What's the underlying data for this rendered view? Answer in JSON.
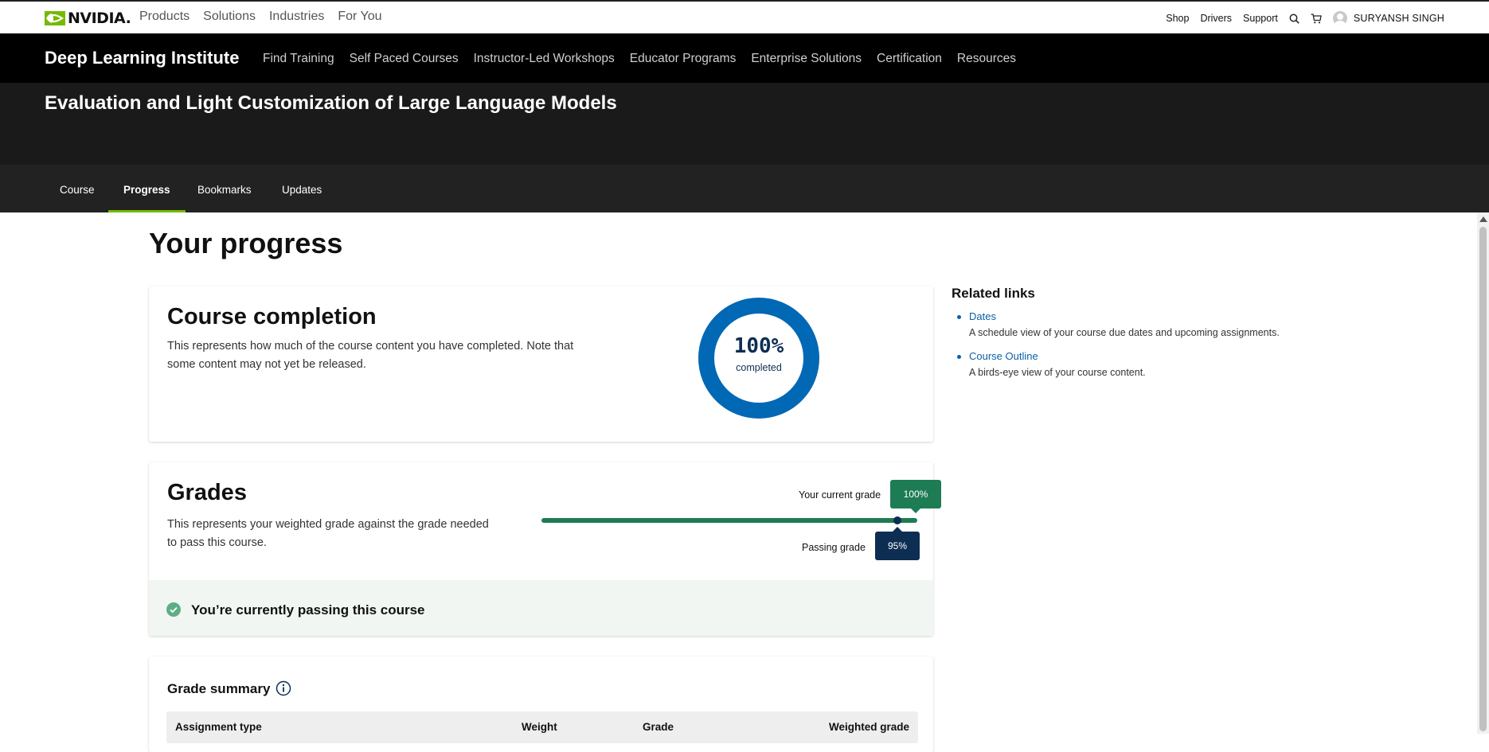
{
  "topbar": {
    "brand": "NVIDIA.",
    "nav": [
      "Products",
      "Solutions",
      "Industries",
      "For You"
    ],
    "links": [
      "Shop",
      "Drivers",
      "Support"
    ],
    "icons": [
      "search-icon",
      "cart-icon",
      "avatar-icon"
    ],
    "user": "SURYANSH SINGH"
  },
  "dli": {
    "title": "Deep Learning Institute",
    "links": [
      "Find Training",
      "Self Paced Courses",
      "Instructor-Led Workshops",
      "Educator Programs",
      "Enterprise Solutions",
      "Certification",
      "Resources"
    ]
  },
  "course": {
    "title": "Evaluation and Light Customization of Large Language Models"
  },
  "tabs": [
    {
      "label": "Course",
      "active": false
    },
    {
      "label": "Progress",
      "active": true
    },
    {
      "label": "Bookmarks",
      "active": false
    },
    {
      "label": "Updates",
      "active": false
    }
  ],
  "page": {
    "heading": "Your progress"
  },
  "completion": {
    "title": "Course completion",
    "desc_line1": "This represents how much of the course content you have completed. Note that",
    "desc_line2": "some content may not yet be released.",
    "percent_label": "100%",
    "percent_value": 100,
    "sub": "completed",
    "color": "#0068b5"
  },
  "grades": {
    "title": "Grades",
    "desc_line1": "This represents your weighted grade against the grade needed",
    "desc_line2": "to pass this course.",
    "current_label": "Your current grade",
    "current_value": "100%",
    "passing_label": "Passing grade",
    "passing_value": "95%",
    "status": "You’re currently passing this course",
    "bar_color": "#1e7c55"
  },
  "grade_summary": {
    "title": "Grade summary",
    "columns": [
      "Assignment type",
      "Weight",
      "Grade",
      "Weighted grade"
    ]
  },
  "related": {
    "title": "Related links",
    "items": [
      {
        "label": "Dates",
        "desc": "A schedule view of your course due dates and upcoming assignments."
      },
      {
        "label": "Course Outline",
        "desc": "A birds-eye view of your course content."
      }
    ]
  }
}
